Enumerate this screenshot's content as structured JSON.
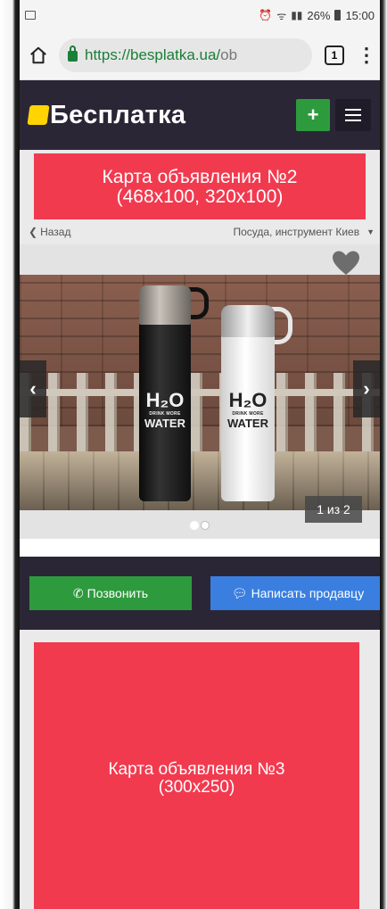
{
  "status_bar": {
    "battery": "26%",
    "time": "15:00"
  },
  "browser": {
    "url_host": "https://besplatka.ua/",
    "url_rest": "ob",
    "tab_count": "1"
  },
  "site": {
    "logo_text": "Бесплатка",
    "add_label": "+"
  },
  "ads": {
    "ad2_line1": "Карта объявления №2",
    "ad2_line2": "(468x100, 320x100)",
    "ad3_line1": "Карта объявления №3",
    "ad3_line2": "(300x250)"
  },
  "breadcrumbs": {
    "back_label": "Назад",
    "category": "Посуда, инструмент Киев"
  },
  "gallery": {
    "counter": "1 из 2",
    "label_main": "H₂O",
    "label_small": "DRINK MORE",
    "label_water": "WATER"
  },
  "actions": {
    "call_label": "Позвонить",
    "message_label": "Написать продавцу"
  },
  "colors": {
    "header_bg": "#2b2636",
    "ad_red": "#f23a4f",
    "call_green": "#2e9a3e",
    "message_blue": "#3a7fe0",
    "logo_yellow": "#ffd400"
  }
}
